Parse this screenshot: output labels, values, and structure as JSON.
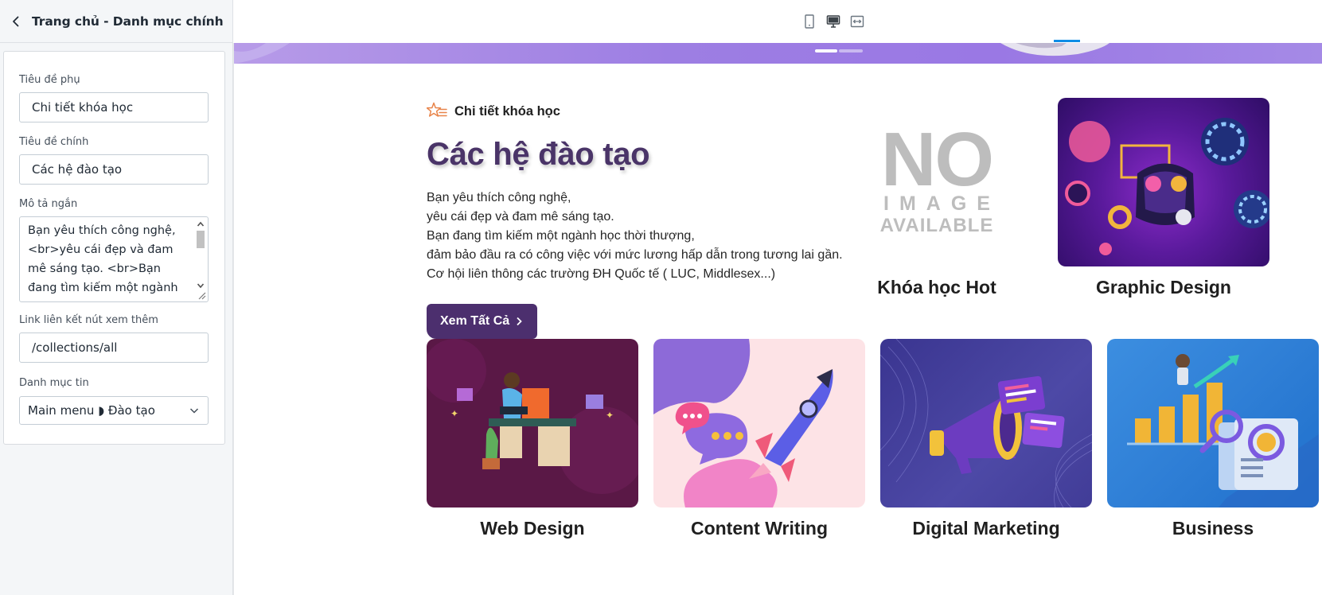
{
  "sidebar": {
    "title": "Trang chủ - Danh mục chính",
    "fields": {
      "subtitle_label": "Tiêu đề phụ",
      "subtitle_value": "Chi tiết khóa học",
      "main_title_label": "Tiêu đề chính",
      "main_title_value": "Các hệ đào tạo",
      "short_desc_label": "Mô tả ngắn",
      "short_desc_value": "Bạn yêu thích công nghệ, <br>yêu cái đẹp và đam mê sáng tạo. <br>Bạn đang tìm kiếm một ngành học",
      "link_label": "Link liên kết nút xem thêm",
      "link_value": "/collections/all",
      "category_label": "Danh mục tin",
      "category_value": "Main menu ◗ Đào tạo"
    }
  },
  "toolbar": {
    "modes": [
      {
        "name": "mobile-view",
        "icon": "mobile-icon",
        "active": false
      },
      {
        "name": "desktop-view",
        "icon": "desktop-icon",
        "active": true
      },
      {
        "name": "fullwidth-view",
        "icon": "fullwidth-icon",
        "active": false
      }
    ],
    "accent": "#0e8de6"
  },
  "preview": {
    "subtitle": "Chi tiết khóa học",
    "title": "Các hệ đào tạo",
    "description_lines": [
      "Bạn yêu thích công nghệ,",
      "yêu cái đẹp và đam mê sáng tạo.",
      "Bạn đang tìm kiếm một ngành học thời thượng,",
      "đảm bảo đầu ra có công việc với mức lương hấp dẫn trong tương lai gần.",
      "Cơ hội liên thông các trường ĐH Quốc tế ( LUC, Middlesex...)"
    ],
    "view_all_label": "Xem Tất Cả",
    "categories": [
      {
        "label": "Khóa học Hot",
        "image": "no-image-placeholder"
      },
      {
        "label": "Graphic Design",
        "image": "graphic-design-illustration"
      },
      {
        "label": "Web Design",
        "image": "web-design-illustration"
      },
      {
        "label": "Content Writing",
        "image": "content-writing-illustration"
      },
      {
        "label": "Digital Marketing",
        "image": "digital-marketing-illustration"
      },
      {
        "label": "Business",
        "image": "business-illustration"
      }
    ],
    "no_image": {
      "line1": "NO",
      "line2": "IMAGE",
      "line3": "AVAILABLE"
    },
    "colors": {
      "title": "#4a3468",
      "button": "#4c2f6e",
      "banner": "#9d7ee3",
      "star": "#e8844a"
    }
  }
}
